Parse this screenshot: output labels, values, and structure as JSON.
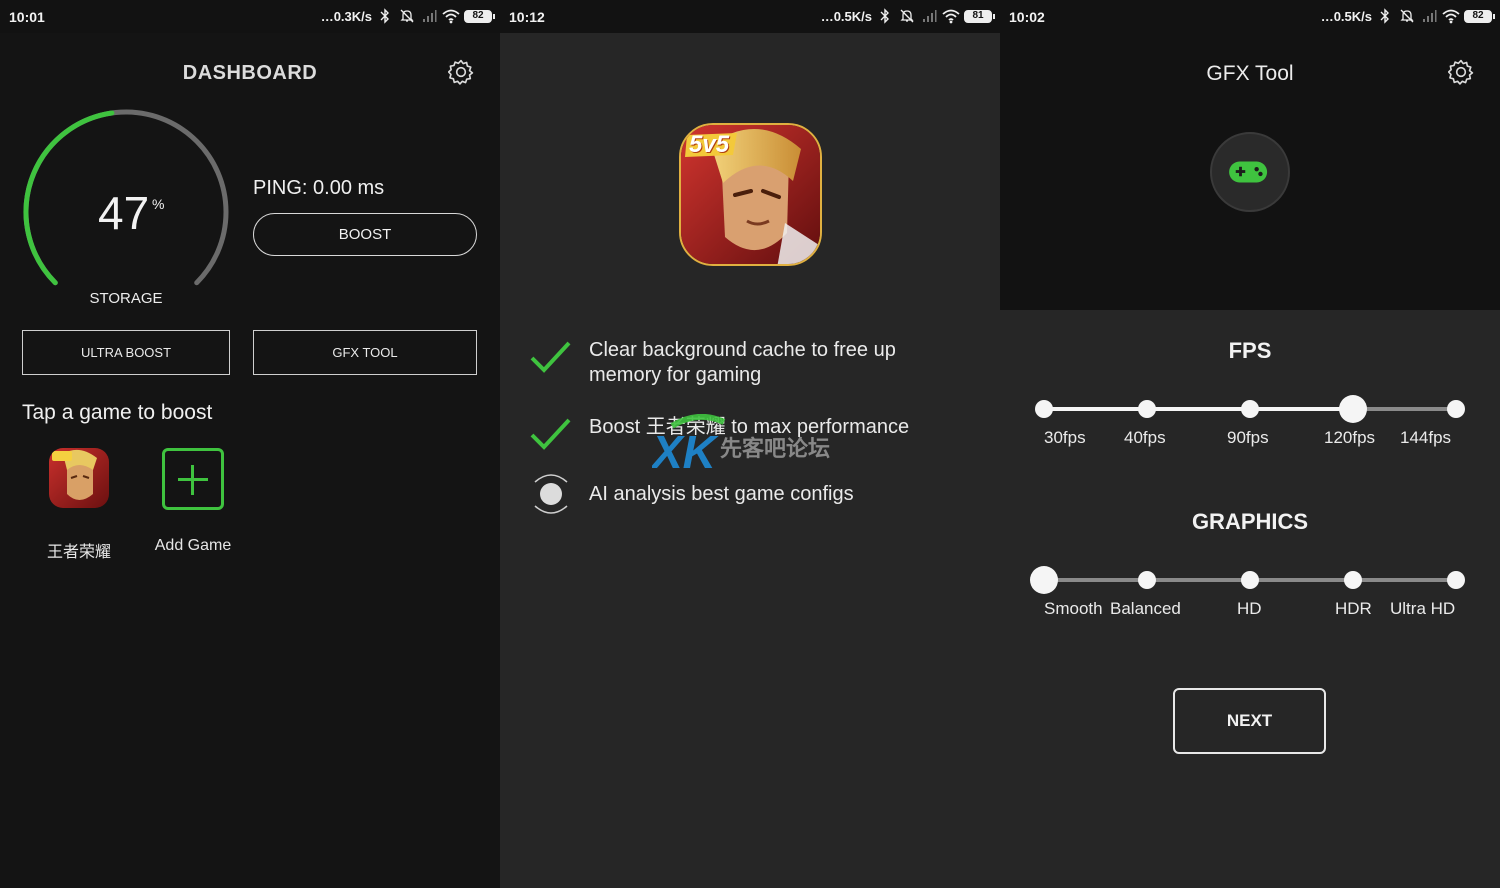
{
  "colors": {
    "accent": "#3fc33f",
    "panel_dark": "#141414",
    "panel_gray": "#262626"
  },
  "screens": [
    {
      "status": {
        "time": "10:01",
        "net": "0.3K/s",
        "battery": "82"
      },
      "title": "DASHBOARD",
      "storage": {
        "value": "47",
        "unit": "%",
        "label": "STORAGE",
        "fraction": 0.47
      },
      "ping": "PING: 0.00 ms",
      "boost_label": "BOOST",
      "ultra_boost_label": "ULTRA BOOST",
      "gfx_tool_label": "GFX TOOL",
      "tap_title": "Tap a game to boost",
      "games": [
        {
          "label": "王者荣耀",
          "icon": "game-icon-5v5"
        },
        {
          "label": "Add Game",
          "icon": "plus-icon"
        }
      ]
    },
    {
      "status": {
        "time": "10:12",
        "net": "0.5K/s",
        "battery": "81"
      },
      "icon_badge": "5v5",
      "steps": [
        {
          "text": "Clear background cache to free up memory for gaming",
          "state": "done"
        },
        {
          "text": "Boost 王者荣耀 to max performance",
          "state": "done"
        },
        {
          "text": "AI analysis best game configs",
          "state": "in-progress"
        }
      ],
      "watermark": {
        "mark": "XK",
        "text": "先客吧论坛"
      }
    },
    {
      "status": {
        "time": "10:02",
        "net": "0.5K/s",
        "battery": "82"
      },
      "title": "GFX Tool",
      "fps": {
        "title": "FPS",
        "options": [
          "30fps",
          "40fps",
          "90fps",
          "120fps",
          "144fps"
        ],
        "selected_index": 3
      },
      "graphics": {
        "title": "GRAPHICS",
        "options": [
          "Smooth",
          "Balanced",
          "HD",
          "HDR",
          "Ultra HD"
        ],
        "selected_index": 0
      },
      "next_label": "NEXT"
    }
  ]
}
